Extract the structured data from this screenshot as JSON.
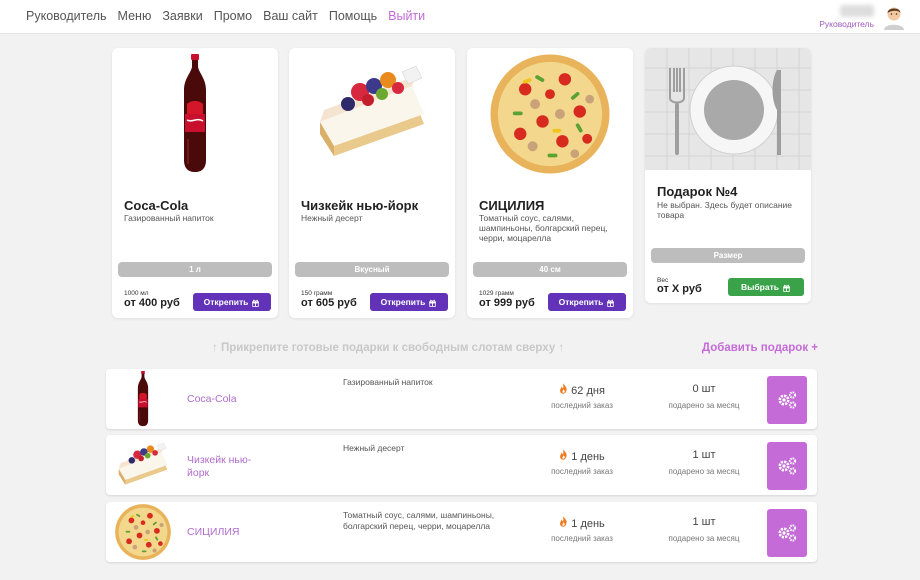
{
  "nav": {
    "items": [
      "Руководитель",
      "Меню",
      "Заявки",
      "Промо",
      "Ваш сайт",
      "Помощь"
    ],
    "logout": "Выйти"
  },
  "user": {
    "role": "Руководитель"
  },
  "cards": [
    {
      "title": "Coca-Cola",
      "desc": "Газированный напиток",
      "pill": "1 л",
      "weight": "1000 мл",
      "price": "от 400 руб",
      "button": "Открепить"
    },
    {
      "title": "Чизкейк нью-йорк",
      "desc": "Нежный десерт",
      "pill": "Вкусный",
      "weight": "150 грамм",
      "price": "от 605 руб",
      "button": "Открепить"
    },
    {
      "title": "СИЦИЛИЯ",
      "desc": "Томатный соус, салями, шампиньоны, болгарский перец, черри, моцарелла",
      "pill": "40 см",
      "weight": "1029 грамм",
      "price": "от 999 руб",
      "button": "Открепить"
    },
    {
      "title": "Подарок №4",
      "desc": "Не выбран. Здесь будет описание товара",
      "pill": "Размер",
      "weight": "Вес",
      "price": "от X руб",
      "button": "Выбрать"
    }
  ],
  "hint": "↑ Прикрепите готовые подарки к свободным слотам сверху ↑",
  "add_gift": "Добавить подарок +",
  "rows": [
    {
      "name": "Coca-Cola",
      "desc": "Газированный напиток",
      "days": "62 дня",
      "days_label": "последний заказ",
      "count": "0 шт",
      "count_label": "подарено за месяц"
    },
    {
      "name": "Чизкейк нью-йорк",
      "desc": "Нежный десерт",
      "days": "1 день",
      "days_label": "последний заказ",
      "count": "1 шт",
      "count_label": "подарено за месяц"
    },
    {
      "name": "СИЦИЛИЯ",
      "desc": "Томатный соус, салями, шампиньоны, болгарский перец, черри, моцарелла",
      "days": "1 день",
      "days_label": "последний заказ",
      "count": "1 шт",
      "count_label": "подарено за месяц"
    }
  ],
  "colors": {
    "accent": "#c46bd8",
    "button_purple": "#6233b8",
    "button_green": "#3aa349",
    "pill": "#bdbdbd"
  },
  "icons": {
    "unpin": "gift-icon",
    "select": "gift-icon",
    "days": "fire-icon",
    "settings": "gears-icon"
  }
}
